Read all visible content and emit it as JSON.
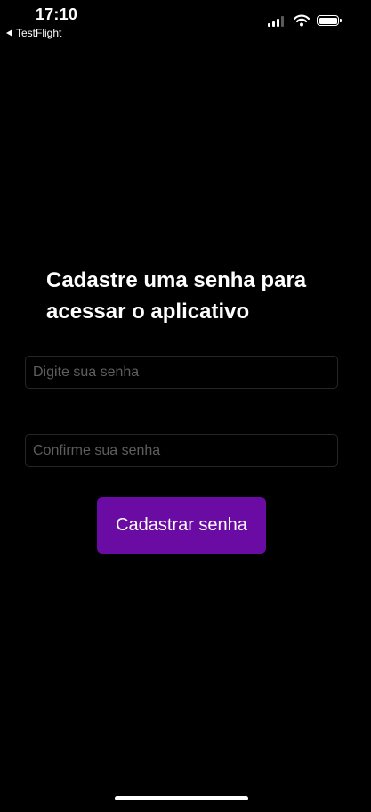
{
  "status_bar": {
    "time": "17:10",
    "back_app_label": "TestFlight",
    "icons": [
      "signal-icon",
      "wifi-icon",
      "battery-icon"
    ]
  },
  "main": {
    "title": "Cadastre uma senha para acessar o aplicativo",
    "password_field": {
      "value": "",
      "placeholder": "Digite sua senha"
    },
    "confirm_field": {
      "value": "",
      "placeholder": "Confirme sua senha"
    },
    "submit_label": "Cadastrar senha"
  },
  "colors": {
    "background": "#000000",
    "accent": "#6a0ba3",
    "text": "#ffffff",
    "placeholder": "#5e5e5e",
    "input_border": "#262626"
  }
}
